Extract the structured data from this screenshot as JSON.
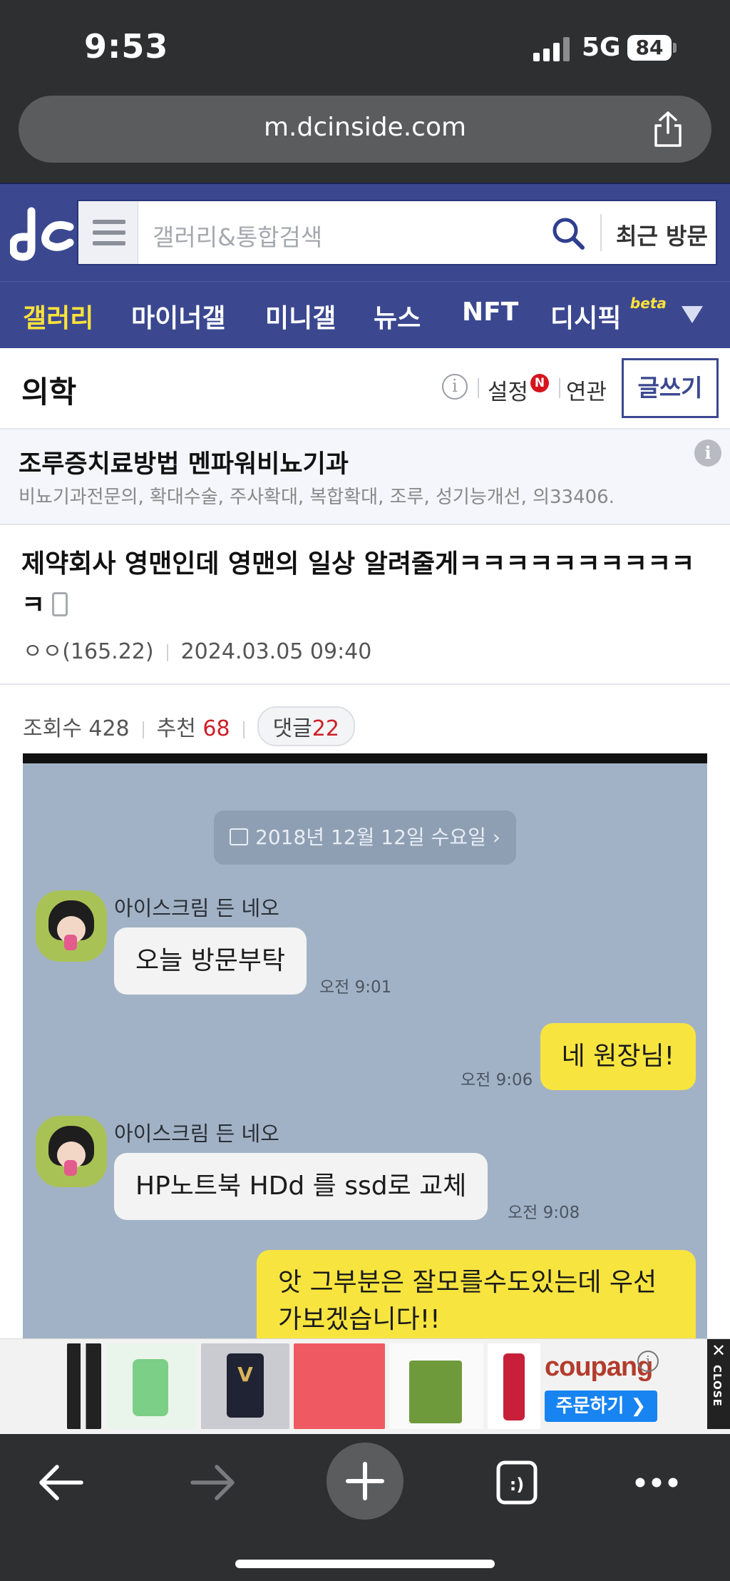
{
  "status": {
    "time": "9:53",
    "network": "5G",
    "battery": "84"
  },
  "browser": {
    "url": "m.dcinside.com"
  },
  "header": {
    "search_placeholder": "갤러리&통합검색",
    "recent_label": "최근 방문"
  },
  "nav": {
    "items": [
      "갤러리",
      "마이너갤",
      "미니갤",
      "뉴스",
      "NFT",
      "디시픽"
    ],
    "beta": "beta"
  },
  "gallery": {
    "title": "의학",
    "settings": "설정",
    "settings_badge": "N",
    "related": "연관",
    "write": "글쓰기"
  },
  "ad_text": {
    "title": "조루증치료방법 멘파워비뇨기과",
    "desc": "비뇨기과전문의, 확대수술, 주사확대, 복합확대, 조루, 성기능개선, 의33406."
  },
  "post": {
    "title": "제약회사 영맨인데 영맨의 일상 알려줄게ㅋㅋㅋㅋㅋㅋㅋㅋㅋㅋㅋ",
    "author": "ㅇㅇ(165.22)",
    "date": "2024.03.05 09:40",
    "views_label": "조회수",
    "views": "428",
    "recommend_label": "추천",
    "recommend": "68",
    "comments_label": "댓글",
    "comments": "22"
  },
  "chat": {
    "date": "2018년 12월 12일 수요일",
    "messages": [
      {
        "sender": "아이스크림 든 네오",
        "text": "오늘 방문부탁",
        "time": "오전 9:01"
      },
      {
        "text": "네 원장님!",
        "time": "오전 9:06"
      },
      {
        "sender": "아이스크림 든 네오",
        "text": "HP노트북 HDd 를 ssd로 교체",
        "time": "오전 9:08"
      },
      {
        "text": "앗 그부분은 잘모를수도있는데 우선 가보겠습니다!!"
      }
    ]
  },
  "banner": {
    "brand": "coupang",
    "order_label": "주문하기 ❯",
    "close_label": "CLOSE"
  },
  "colors": {
    "header_blue": "#3b4890",
    "nav_active": "#ffe23a",
    "accent_red": "#cc1f27",
    "chat_bg": "#a2b2c6",
    "bubble_yellow": "#f7e43f"
  }
}
